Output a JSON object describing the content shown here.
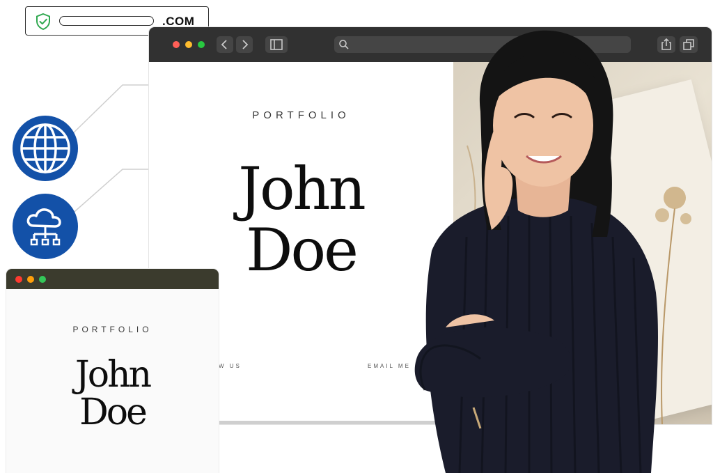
{
  "address_badge": {
    "tld": ".COM"
  },
  "main_window": {
    "portfolio_label": "PORTFOLIO",
    "name_first": "John",
    "name_last": "Doe",
    "link_follow": "W US",
    "link_email": "EMAIL ME"
  },
  "preview_window": {
    "portfolio_label": "PORTFOLIO",
    "name_first": "John",
    "name_last": "Doe"
  },
  "icons": {
    "badge": "shield-check-icon",
    "globe": "globe-icon",
    "cloud": "cloud-network-icon"
  },
  "colors": {
    "brand_blue": "#1351a8",
    "shield_green": "#2fa84f",
    "close": "#ff5f57",
    "minimize": "#febc2e",
    "maximize": "#28c840"
  }
}
